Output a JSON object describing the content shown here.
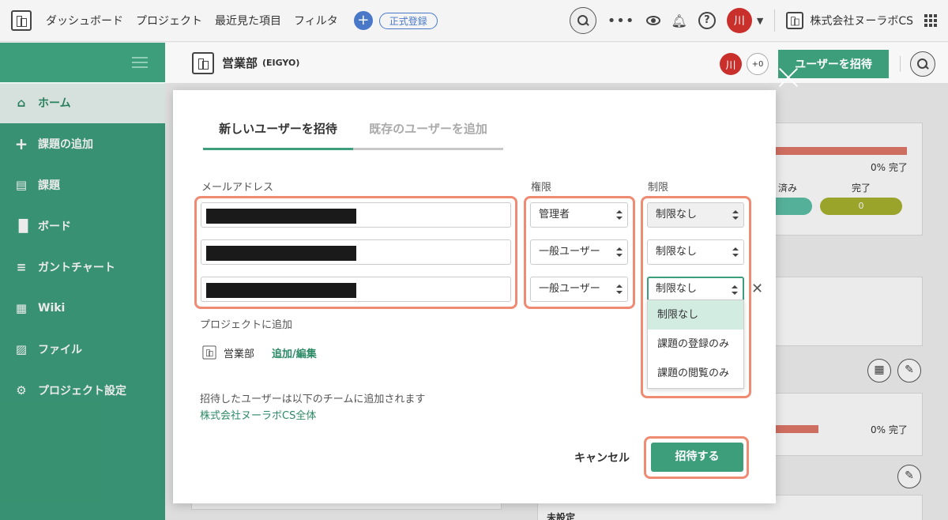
{
  "topbar": {
    "nav": [
      "ダッシュボード",
      "プロジェクト",
      "最近見た項目",
      "フィルタ"
    ],
    "register_label": "正式登録",
    "user_initial": "川",
    "company_name": "株式会社ヌーラボCS"
  },
  "sidebar": {
    "items": [
      {
        "label": "ホーム",
        "icon": "home-icon",
        "active": true
      },
      {
        "label": "課題の追加",
        "icon": "plus-icon"
      },
      {
        "label": "課題",
        "icon": "list-icon"
      },
      {
        "label": "ボード",
        "icon": "board-icon"
      },
      {
        "label": "ガントチャート",
        "icon": "gantt-icon"
      },
      {
        "label": "Wiki",
        "icon": "wiki-icon"
      },
      {
        "label": "ファイル",
        "icon": "file-icon"
      },
      {
        "label": "プロジェクト設定",
        "icon": "gear-icon"
      }
    ]
  },
  "project_header": {
    "name": "営業部",
    "key": "(EIGYO)",
    "member_initial": "川",
    "extra_members": "+0",
    "invite_label": "ユーザーを招待"
  },
  "background": {
    "progress_label_1": "0% 完了",
    "status_label_a": "済み",
    "status_label_b": "完了",
    "count_value": "0",
    "progress_label_2": "0% 完了",
    "footer_text": "未設定"
  },
  "modal": {
    "tabs": [
      "新しいユーザーを招待",
      "既存のユーザーを追加"
    ],
    "labels": {
      "email": "メールアドレス",
      "role": "権限",
      "restriction": "制限"
    },
    "rows": [
      {
        "role": "管理者",
        "restriction": "制限なし"
      },
      {
        "role": "一般ユーザー",
        "restriction": "制限なし"
      },
      {
        "role": "一般ユーザー",
        "restriction": "制限なし"
      }
    ],
    "restriction_options": [
      "制限なし",
      "課題の登録のみ",
      "課題の閲覧のみ"
    ],
    "add_to_project_label": "プロジェクトに追加",
    "project_name": "営業部",
    "edit_link": "追加/編集",
    "team_note": "招待したユーザーは以下のチームに追加されます",
    "team_link": "株式会社ヌーラボCS全体",
    "cancel_label": "キャンセル",
    "submit_label": "招待する"
  },
  "colors": {
    "brand_green": "#3d9e7c",
    "highlight": "#ef8a73",
    "avatar_red": "#c9302c"
  }
}
